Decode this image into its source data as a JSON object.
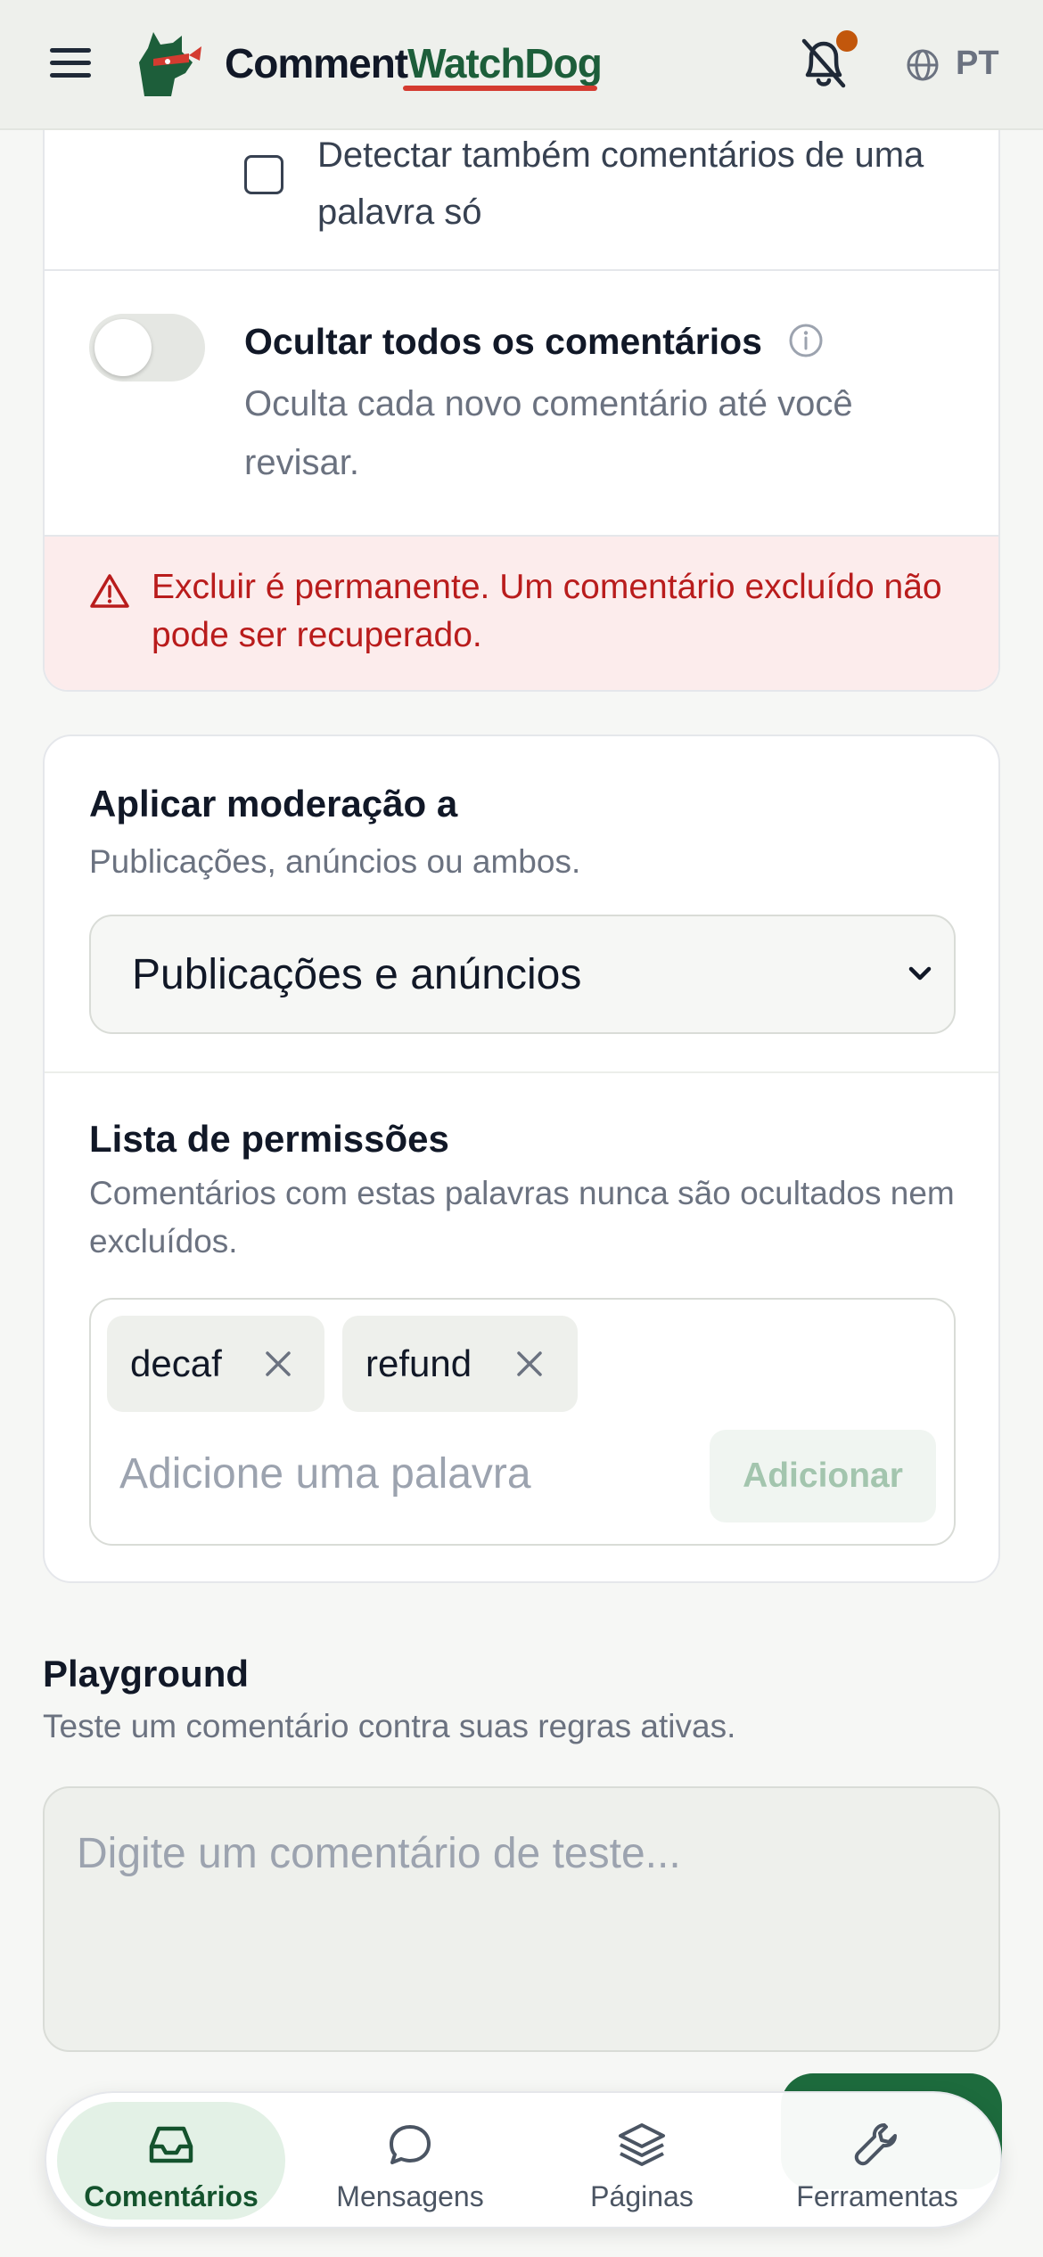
{
  "header": {
    "brand_part1": "Comment",
    "brand_part2": "WatchDog",
    "language": "PT",
    "notification_badge": true
  },
  "moderation": {
    "single_word_checkbox_label": "Detectar também comentários de uma palavra só",
    "single_word_checked": false,
    "hide_all_title": "Ocultar todos os comentários",
    "hide_all_desc": "Oculta cada novo comentário até você revisar.",
    "hide_all_enabled": false,
    "delete_warning": "Excluir é permanente. Um comentário excluído não pode ser recuperado."
  },
  "apply_to": {
    "title": "Aplicar moderação a",
    "subtitle": "Publicações, anúncios ou ambos.",
    "selected": "Publicações e anúncios"
  },
  "allowlist": {
    "title": "Lista de permissões",
    "subtitle": "Comentários com estas palavras nunca são ocultados nem excluídos.",
    "tags": [
      "decaf",
      "refund"
    ],
    "input_placeholder": "Adicione uma palavra",
    "add_button": "Adicionar"
  },
  "playground": {
    "title": "Playground",
    "subtitle": "Teste um comentário contra suas regras ativas.",
    "placeholder": "Digite um comentário de teste..."
  },
  "bottom_nav": [
    {
      "label": "Comentários",
      "icon": "inbox-icon",
      "active": true
    },
    {
      "label": "Mensagens",
      "icon": "chat-bubble-icon",
      "active": false
    },
    {
      "label": "Páginas",
      "icon": "layers-icon",
      "active": false
    },
    {
      "label": "Ferramentas",
      "icon": "wrench-icon",
      "active": false
    }
  ],
  "colors": {
    "brand_green": "#1d5e3a",
    "accent_red": "#d43b30",
    "alert_bg": "#fcecec",
    "alert_text": "#b91c1c",
    "notification_dot": "#c2570c"
  }
}
